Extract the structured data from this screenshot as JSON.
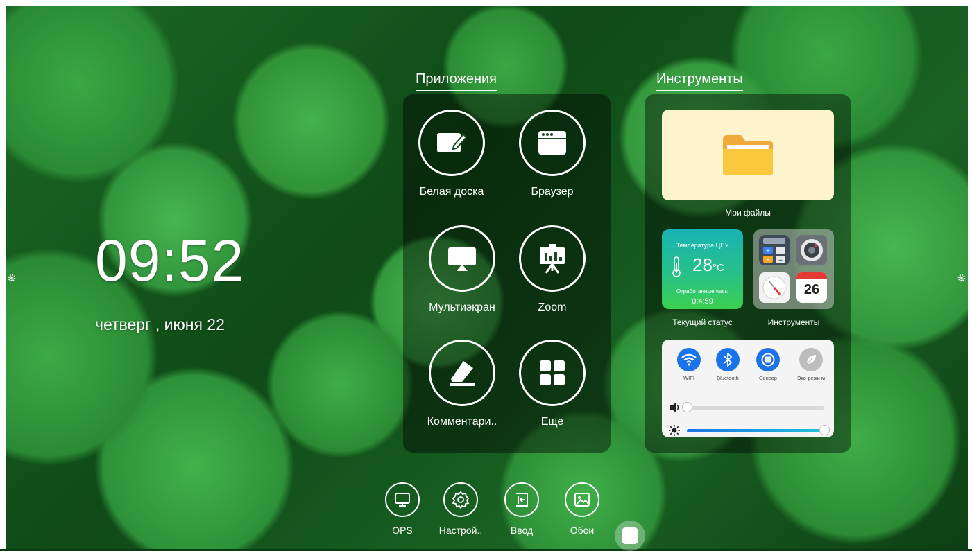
{
  "clock": {
    "time": "09:52",
    "date": "четверг , июня 22"
  },
  "apps": {
    "title": "Приложения",
    "items": [
      {
        "label": "Белая доска",
        "icon": "whiteboard-icon"
      },
      {
        "label": "Браузер",
        "icon": "browser-icon"
      },
      {
        "label": "Мультиэкран",
        "icon": "multiscreen-icon"
      },
      {
        "label": "Zoom",
        "icon": "presentation-icon"
      },
      {
        "label": "Комментари..",
        "icon": "eraser-icon"
      },
      {
        "label": "Еще",
        "icon": "grid-icon"
      }
    ]
  },
  "tools": {
    "title": "Инструменты",
    "files_label": "Мои файлы",
    "status": {
      "cpu_title": "Температура ЦПУ",
      "temp_value": "28",
      "temp_unit": "°C",
      "hours_label": "Отработанные часы",
      "hours_value": "0:4:59",
      "label": "Текущий статус"
    },
    "tools_card": {
      "label": "Инструменты",
      "calendar_day": "26"
    },
    "toggles": [
      {
        "label": "WIFI",
        "icon": "wifi-icon",
        "on": true
      },
      {
        "label": "Bluetooth",
        "icon": "bluetooth-icon",
        "on": true
      },
      {
        "label": "Сенсор",
        "icon": "touch-icon",
        "on": true
      },
      {
        "label": "Эко-режи м",
        "icon": "leaf-icon",
        "on": false
      }
    ],
    "volume_level": 0.0,
    "brightness_level": 1.0
  },
  "dock": [
    {
      "label": "OPS",
      "icon": "monitor-icon"
    },
    {
      "label": "Настрой..",
      "icon": "settings-icon"
    },
    {
      "label": "Ввод",
      "icon": "input-icon"
    },
    {
      "label": "Обои",
      "icon": "wallpaper-icon"
    }
  ],
  "colors": {
    "accent": "#1a73e8",
    "status_top": "#18b3b5",
    "status_bottom": "#3bd04f",
    "files_bg": "#fdf4cd",
    "folder": "#f5b83d"
  }
}
